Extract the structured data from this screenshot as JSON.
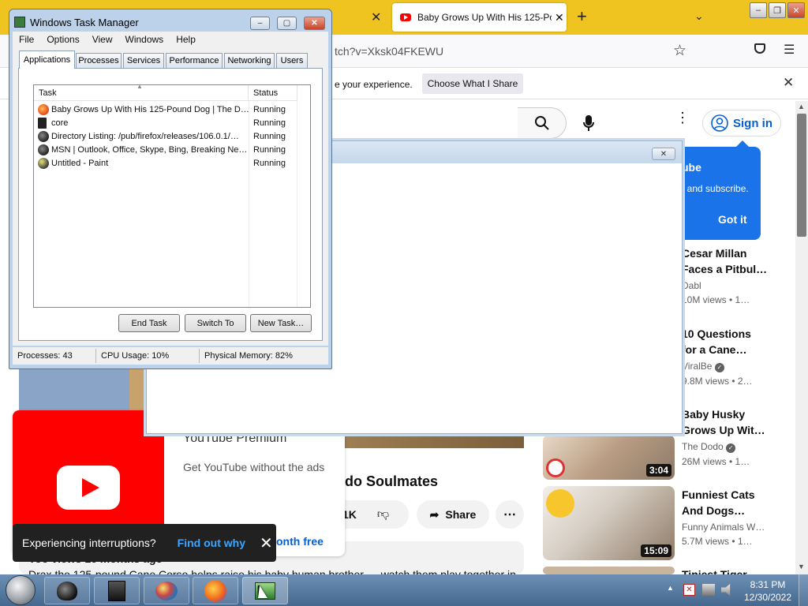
{
  "browser": {
    "tab_title": "Baby Grows Up With His 125-Po",
    "url": "tch?v=Xksk04FKEWU",
    "notice_text": "e your experience.",
    "notice_button": "Choose What I Share"
  },
  "youtube": {
    "signin": "Sign in",
    "tip": {
      "title": "ube",
      "text": ", and subscribe.",
      "button": "Got it"
    },
    "sidebar": [
      {
        "title1": "Cesar Millan",
        "title2": "Faces a Pitbul…",
        "channel": "Dabl",
        "meta": "10M views  •  1…"
      },
      {
        "title1": "10 Questions",
        "title2": "for a Cane…",
        "channel": "ViralBe",
        "meta": "9.8M views  •  2…"
      },
      {
        "title1": "Baby Husky",
        "title2": "Grows Up Wit…",
        "channel": "The Dodo",
        "meta": "26M views  •  1…",
        "duration": "3:04"
      },
      {
        "title1": "Funniest Cats",
        "title2": "And Dogs…",
        "channel": "Funny Animals W…",
        "meta": "5.7M views  •  1…",
        "duration": "15:09"
      },
      {
        "title1": "Tiniest Tiger"
      }
    ],
    "video_title": "odo Soulmates",
    "likes": "1K",
    "share": "Share",
    "description_line1": "Yoo views  16 months ago",
    "description_line2": "Drax the 125-pound Cane Corso helps raise his baby human brother — watch them play together in",
    "premium": {
      "title": "YouTube Premium",
      "text": "Get YouTube without the ads",
      "cta": "onth free"
    }
  },
  "toast": {
    "text": "Experiencing interruptions?",
    "link": "Find out why"
  },
  "taskmanager": {
    "title": "Windows Task Manager",
    "menu": [
      "File",
      "Options",
      "View",
      "Windows",
      "Help"
    ],
    "tabs": [
      "Applications",
      "Processes",
      "Services",
      "Performance",
      "Networking",
      "Users"
    ],
    "columns": {
      "task": "Task",
      "status": "Status"
    },
    "rows": [
      {
        "task": "Baby Grows Up With His 125-Pound Dog | The D…",
        "status": "Running",
        "icon": "firefox-icon"
      },
      {
        "task": "core",
        "status": "Running",
        "icon": "cmd-icon"
      },
      {
        "task": "Directory Listing: /pub/firefox/releases/106.0.1/…",
        "status": "Running",
        "icon": "firefox-icon"
      },
      {
        "task": "MSN | Outlook, Office, Skype, Bing, Breaking Ne…",
        "status": "Running",
        "icon": "firefox-icon"
      },
      {
        "task": "Untitled - Paint",
        "status": "Running",
        "icon": "paint-icon"
      }
    ],
    "buttons": {
      "end": "End Task",
      "switch": "Switch To",
      "new": "New Task…"
    },
    "status": {
      "processes": "Processes: 43",
      "cpu": "CPU Usage: 10%",
      "memory": "Physical Memory: 82%"
    }
  },
  "taskbar": {
    "time": "8:31 PM",
    "date": "12/30/2022"
  }
}
